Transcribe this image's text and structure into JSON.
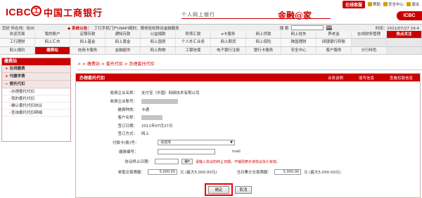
{
  "header": {
    "logo_text": "ICBC",
    "logo_mark": "工",
    "bank_name": "中国工商银行",
    "personal_bank": "个人网上银行",
    "finance_home": "金融@家",
    "top_links": {
      "online_service": "在线客服",
      "help": "帮助",
      "security": "安全中心",
      "logout": "退出"
    },
    "right_logo": "ICBC"
  },
  "info_bar": {
    "user": "您好  所在地：杭州",
    "notice_label": "系统公告：",
    "notice_text": "丁行手机门户(WAP)随时、随地轻松移动金融服务",
    "search_label": "搜 索",
    "search_value": "",
    "go": "GO",
    "date": "时间：2011/07/27 19:4"
  },
  "nav": {
    "rows": [
      [
        "欢迎页面",
        "我的账户",
        "定期存款",
        "通知存款",
        "公益捐款",
        "转债汇款",
        "e卡服务",
        "网上贷款",
        "网上挂失",
        "养老金",
        "在线财务管理",
        "热点关注"
      ],
      [
        "工行理财",
        "网上汇市",
        "网上基金",
        "网上黄金",
        "网上国债",
        "个人外汇业务",
        "网上期货",
        "网上保险",
        "跨国理财",
        "网银银行转账",
        "",
        ""
      ],
      [
        "网上捐钓",
        "缴费站",
        "信用卡服务",
        "金融超市",
        "网上购物",
        "工银信使",
        "电子银行注册",
        "银行卡服务",
        "安全中心",
        "客户服务",
        "分行特色",
        ""
      ]
    ],
    "active": "缴费站",
    "hot": "热点关注"
  },
  "sidebar": {
    "title": "缴费站",
    "groups": [
      {
        "label": "在线缴费",
        "items": []
      },
      {
        "label": "代缴学费",
        "items": []
      },
      {
        "label": "委托代扣",
        "items": [
          "办理委托代扣",
          "我的委托代扣",
          "确认委托代扣协议",
          "查询委托代扣明细"
        ]
      }
    ]
  },
  "breadcrumb": "> > 缴费站 > 委托代扣 > 办理委托代扣",
  "panel": {
    "title": "办理委托代扣",
    "links": [
      "业务说明",
      "填写信息",
      "查看扣款信息"
    ],
    "fields": [
      {
        "label": "收费企业名称：",
        "value": "支付宝（中国）网络技术有限公司",
        "masked": false
      },
      {
        "label": "收费企业账号：",
        "value": "",
        "masked": true
      },
      {
        "label": "缴费种类：",
        "value": "卡通",
        "masked": false
      },
      {
        "label": "客户名称：",
        "value": "",
        "masked": true
      },
      {
        "label": "签订日期：",
        "value": "2011年07月27日",
        "masked": false
      },
      {
        "label": "签订方式：",
        "value": "网上",
        "masked": false
      }
    ],
    "payment_card_label": "付款卡(账)号：",
    "payment_card_placeholder": "请选择",
    "payee_no_label": "缴费编号：",
    "payee_no_suffix": "mail",
    "end_date_label": "协议终止日期：",
    "end_date_value": "",
    "end_date_hint": "请输入协议的终止日期，不输则表示该协议永久有效。",
    "single_limit_label": "单笔交易限额：",
    "single_limit_value": "5,000.00",
    "single_limit_unit": "元  (最大5,000.00元)",
    "daily_limit_label": "当日累计交易限额：",
    "daily_limit_value": "5,000.00",
    "daily_limit_unit": "元  (最大5,000.00元)",
    "confirm": "确定",
    "cancel": "取消"
  },
  "colors": {
    "brand_red": "#cc0000",
    "hint_red": "#cc0000"
  }
}
